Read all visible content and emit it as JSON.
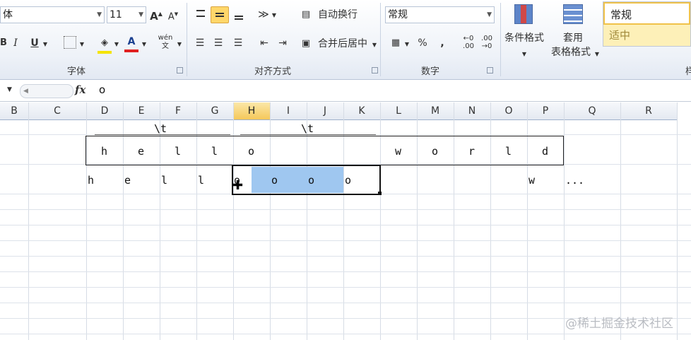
{
  "ribbon": {
    "font_name": "体",
    "font_size": "11",
    "increase_font": "A",
    "decrease_font": "A",
    "italic": "I",
    "underline": "U",
    "font_color_letter": "A",
    "phonetic": "wén",
    "group_font": "字体",
    "wrap_text": "自动换行",
    "merge_center": "合并后居中",
    "group_alignment": "对齐方式",
    "number_format": "常规",
    "percent": "%",
    "comma": ",",
    "increase_decimal": ".00",
    "decrease_decimal": ".00",
    "group_number": "数字",
    "conditional_format": "条件格式",
    "table_format_line1": "套用",
    "table_format_line2": "表格格式",
    "style_normal": "常规",
    "style_neutral": "适中",
    "group_styles_partial": "样"
  },
  "formula_bar": {
    "fx": "fx",
    "content": "o"
  },
  "columns": [
    "B",
    "C",
    "D",
    "E",
    "F",
    "G",
    "H",
    "I",
    "J",
    "K",
    "L",
    "M",
    "N",
    "O",
    "P",
    "Q",
    "R"
  ],
  "row_top_labels": {
    "tab1": "\\t",
    "tab2": "\\t"
  },
  "row_box": [
    "h",
    "e",
    "l",
    "l",
    "o",
    "w",
    "o",
    "r",
    "l",
    "d"
  ],
  "row_output": [
    "h",
    "e",
    "l",
    "l",
    "o",
    "o",
    "o",
    "o",
    "w",
    "..."
  ],
  "watermark": "@稀土掘金技术社区"
}
